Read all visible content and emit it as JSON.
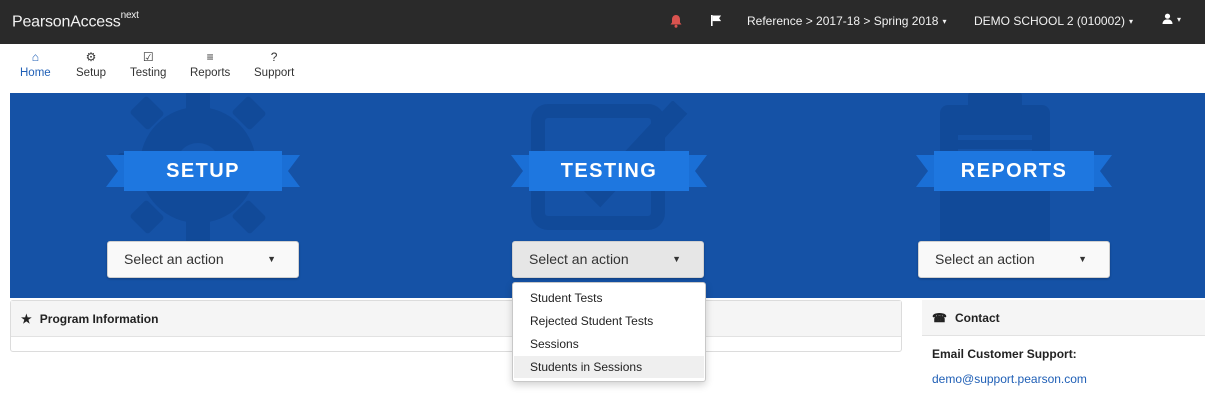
{
  "app": {
    "brand": "PearsonAccess",
    "brand_sup": "next",
    "breadcrumb": "Reference > 2017-18 > Spring 2018",
    "organization": "DEMO SCHOOL 2 (010002)",
    "caret": "▾"
  },
  "nav": {
    "items": [
      {
        "label": "Home",
        "icon": "home-icon",
        "glyph": "⌂"
      },
      {
        "label": "Setup",
        "icon": "gear-icon",
        "glyph": "⚙"
      },
      {
        "label": "Testing",
        "icon": "checkbox-icon",
        "glyph": "☑"
      },
      {
        "label": "Reports",
        "icon": "report-icon",
        "glyph": "≡"
      },
      {
        "label": "Support",
        "icon": "question-icon",
        "glyph": "?"
      }
    ],
    "active": "Home"
  },
  "hero": {
    "sections": [
      {
        "title": "SETUP",
        "dropdown": "Select an action"
      },
      {
        "title": "TESTING",
        "dropdown": "Select an action"
      },
      {
        "title": "REPORTS",
        "dropdown": "Select an action"
      }
    ],
    "caret": "▼",
    "background": "#1552a6"
  },
  "testing_menu": {
    "items": [
      "Student Tests",
      "Rejected Student Tests",
      "Sessions",
      "Students in Sessions"
    ],
    "highlighted": "Students in Sessions"
  },
  "program_panel": {
    "title": "Program Information",
    "icon": "star-icon",
    "glyph": "★"
  },
  "contact_panel": {
    "title": "Contact",
    "icon": "phone-icon",
    "glyph": "☎",
    "email_label": "Email Customer Support:",
    "email": "demo@support.pearson.com"
  },
  "colors": {
    "accent": "#1f5fb6",
    "ribbon": "#1e77e0",
    "topbar": "#2a2a2a",
    "alert": "#d9534f"
  }
}
